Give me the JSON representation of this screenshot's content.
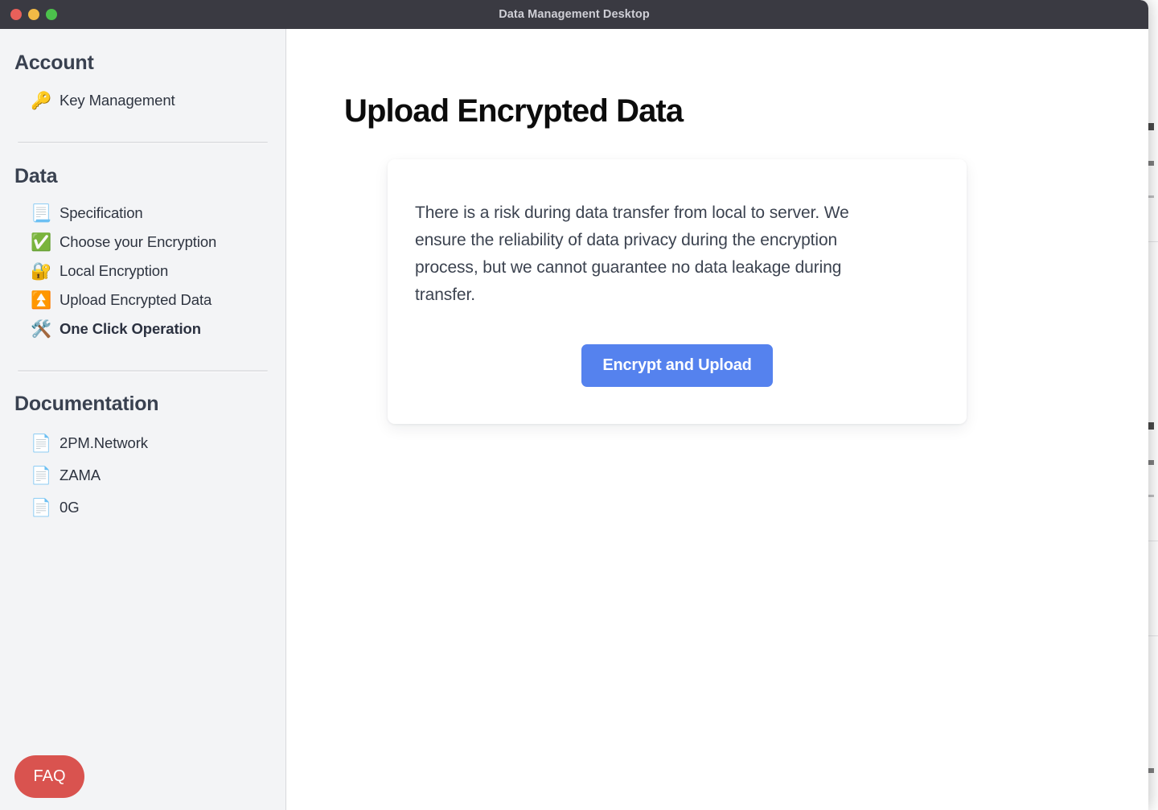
{
  "window": {
    "title": "Data Management Desktop",
    "controls": {
      "close_label": "close",
      "minimize_label": "minimize",
      "zoom_label": "zoom"
    }
  },
  "sidebar": {
    "sections": [
      {
        "title": "Account",
        "items": [
          {
            "icon": "🔑",
            "icon_name": "key-icon",
            "label": "Key Management",
            "active": false
          }
        ]
      },
      {
        "title": "Data",
        "items": [
          {
            "icon": "📃",
            "icon_name": "page-with-curl-icon",
            "label": "Specification",
            "active": false
          },
          {
            "icon": "✅",
            "icon_name": "green-check-icon",
            "label": "Choose your Encryption",
            "active": false
          },
          {
            "icon": "🔐",
            "icon_name": "locked-with-key-icon",
            "label": "Local Encryption",
            "active": false
          },
          {
            "icon": "⏫",
            "icon_name": "fast-up-button-icon",
            "label": "Upload Encrypted Data",
            "active": false
          },
          {
            "icon": "🛠️",
            "icon_name": "hammer-and-wrench-icon",
            "label": "One Click Operation",
            "active": true
          }
        ]
      },
      {
        "title": "Documentation",
        "items": [
          {
            "icon": "📄",
            "icon_name": "page-facing-up-icon",
            "label": "2PM.Network",
            "active": false
          },
          {
            "icon": "📄",
            "icon_name": "page-facing-up-icon",
            "label": "ZAMA",
            "active": false
          },
          {
            "icon": "📄",
            "icon_name": "page-facing-up-icon",
            "label": "0G",
            "active": false
          }
        ]
      }
    ],
    "faq_label": "FAQ"
  },
  "main": {
    "page_title": "Upload Encrypted Data",
    "notice": "There is a risk during data transfer from local to server. We ensure the reliability of data privacy during the encryption process, but we cannot guarantee no data leakage during transfer.",
    "primary_button_label": "Encrypt and Upload"
  },
  "colors": {
    "titlebar": "#3a3a42",
    "sidebar": "#f3f4f6",
    "accent_blue": "#5582ee",
    "faq_red": "#d9534f",
    "heading": "#0c0c0c",
    "body_text": "#3c4350",
    "traffic_close": "#e8605a",
    "traffic_min": "#f1ba46",
    "traffic_zoom": "#4cc14c"
  }
}
